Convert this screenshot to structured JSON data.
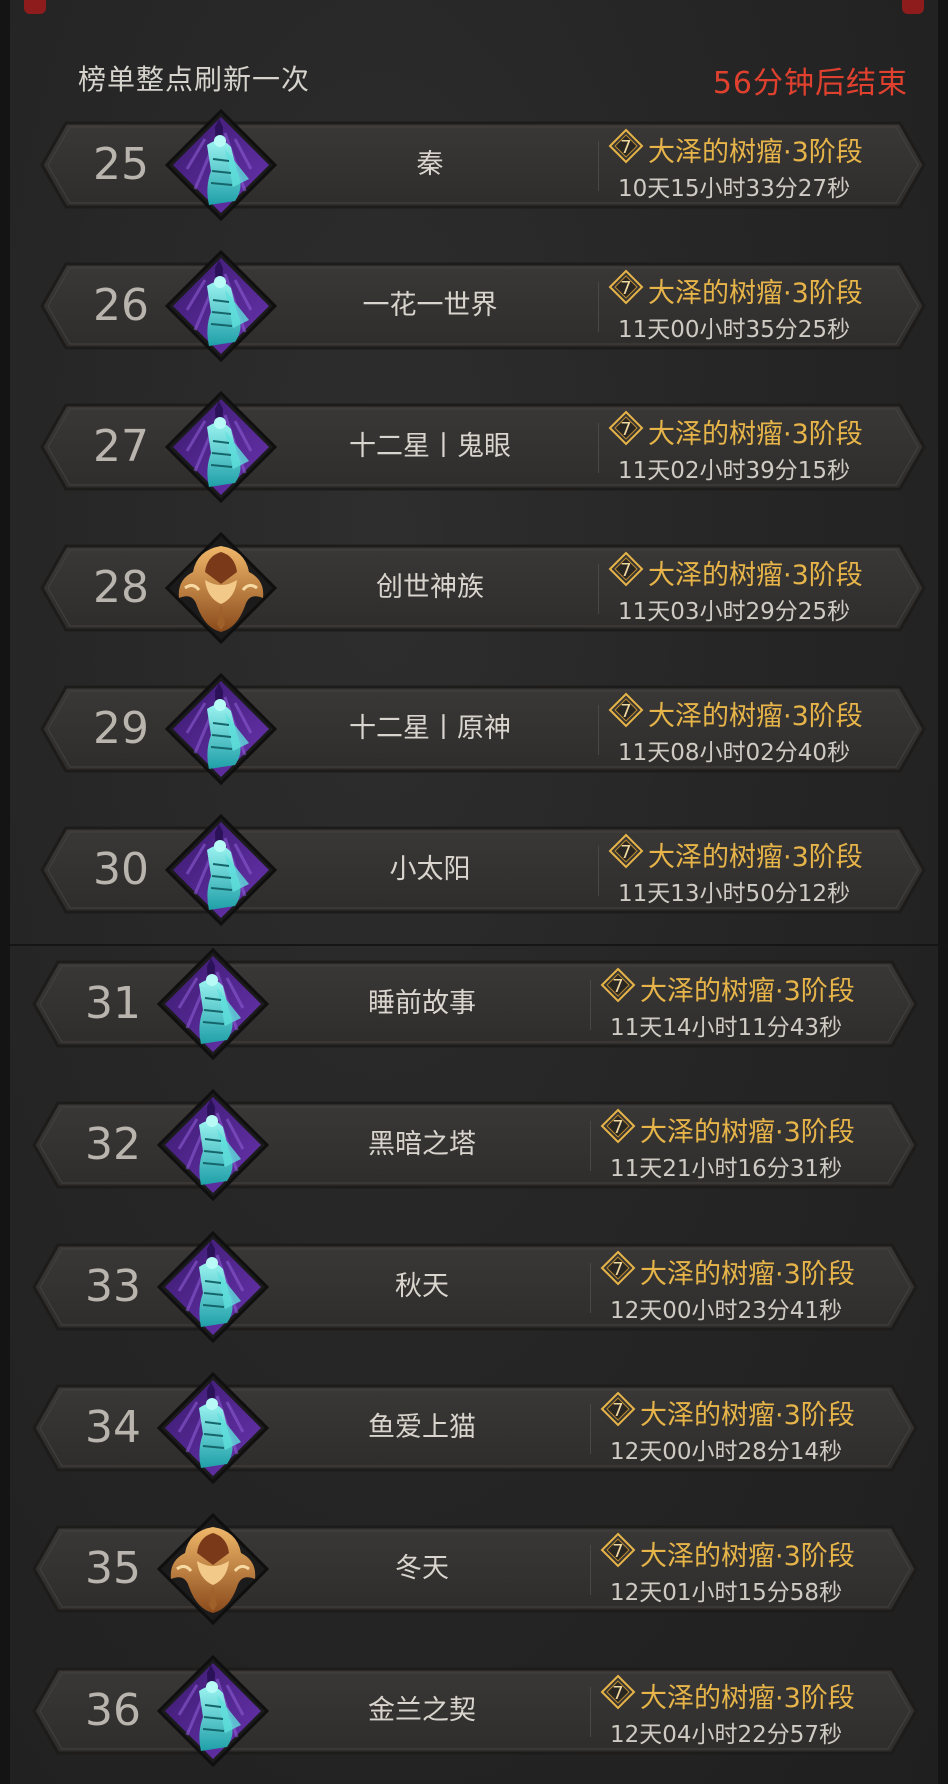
{
  "header": {
    "refresh_note": "榜单整点刷新一次",
    "countdown": "56分钟后结束"
  },
  "colors": {
    "accent_gold": "#e6b449",
    "countdown_red": "#e0412f",
    "emblem_purple": "#5b2a99",
    "emblem_cyan": "#3fd1d1",
    "emblem_bronze": "#c98b3c"
  },
  "rows": [
    {
      "rank": "25",
      "name": "秦",
      "stage_level": "7",
      "stage": "大泽的树瘤·3阶段",
      "time": "10天15小时33分27秒",
      "emblem": "purple-cyan-mage-icon"
    },
    {
      "rank": "26",
      "name": "一花一世界",
      "stage_level": "7",
      "stage": "大泽的树瘤·3阶段",
      "time": "11天00小时35分25秒",
      "emblem": "purple-cyan-mage-icon"
    },
    {
      "rank": "27",
      "name": "十二星丨鬼眼",
      "stage_level": "7",
      "stage": "大泽的树瘤·3阶段",
      "time": "11天02小时39分15秒",
      "emblem": "purple-cyan-mage-icon"
    },
    {
      "rank": "28",
      "name": "创世神族",
      "stage_level": "7",
      "stage": "大泽的树瘤·3阶段",
      "time": "11天03小时29分25秒",
      "emblem": "bronze-crest-icon"
    },
    {
      "rank": "29",
      "name": "十二星丨原神",
      "stage_level": "7",
      "stage": "大泽的树瘤·3阶段",
      "time": "11天08小时02分40秒",
      "emblem": "purple-cyan-mage-icon"
    },
    {
      "rank": "30",
      "name": "小太阳",
      "stage_level": "7",
      "stage": "大泽的树瘤·3阶段",
      "time": "11天13小时50分12秒",
      "emblem": "purple-cyan-mage-icon"
    },
    {
      "rank": "31",
      "name": "睡前故事",
      "stage_level": "7",
      "stage": "大泽的树瘤·3阶段",
      "time": "11天14小时11分43秒",
      "emblem": "purple-cyan-mage-icon"
    },
    {
      "rank": "32",
      "name": "黑暗之塔",
      "stage_level": "7",
      "stage": "大泽的树瘤·3阶段",
      "time": "11天21小时16分31秒",
      "emblem": "purple-cyan-mage-icon"
    },
    {
      "rank": "33",
      "name": "秋天",
      "stage_level": "7",
      "stage": "大泽的树瘤·3阶段",
      "time": "12天00小时23分41秒",
      "emblem": "purple-cyan-mage-icon"
    },
    {
      "rank": "34",
      "name": "鱼爱上猫",
      "stage_level": "7",
      "stage": "大泽的树瘤·3阶段",
      "time": "12天00小时28分14秒",
      "emblem": "purple-cyan-mage-icon"
    },
    {
      "rank": "35",
      "name": "冬天",
      "stage_level": "7",
      "stage": "大泽的树瘤·3阶段",
      "time": "12天01小时15分58秒",
      "emblem": "bronze-crest-icon"
    },
    {
      "rank": "36",
      "name": "金兰之契",
      "stage_level": "7",
      "stage": "大泽的树瘤·3阶段",
      "time": "12天04小时22分57秒",
      "emblem": "purple-cyan-mage-icon"
    }
  ]
}
